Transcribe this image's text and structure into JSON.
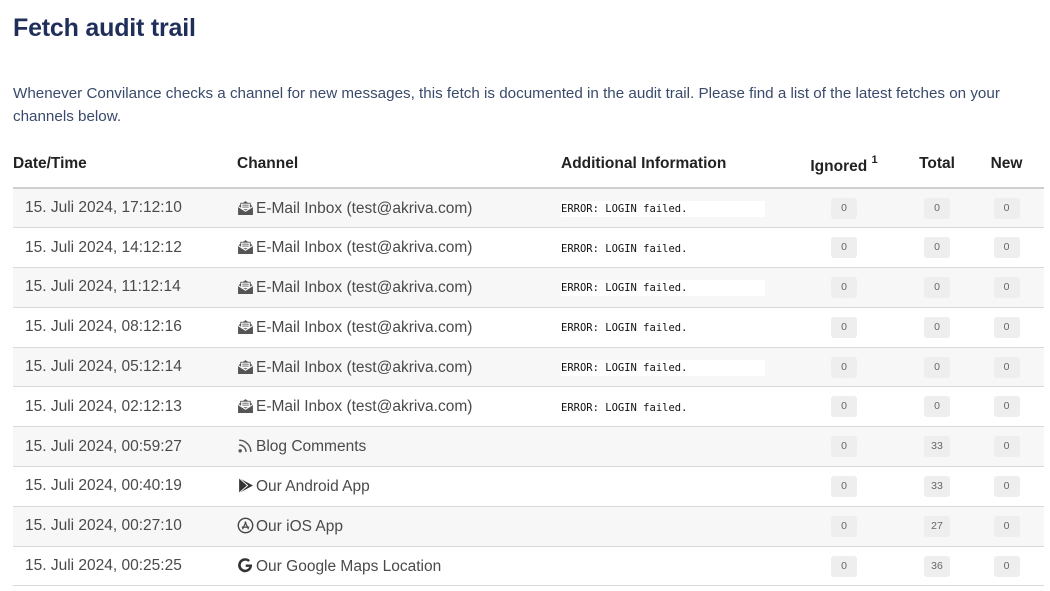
{
  "page": {
    "title": "Fetch audit trail",
    "intro": "Whenever Convilance checks a channel for new messages, this fetch is documented in the audit trail. Please find a list of the latest fetches on your channels below."
  },
  "table": {
    "headers": {
      "datetime": "Date/Time",
      "channel": "Channel",
      "info": "Additional Information",
      "ignored": "Ignored",
      "ignored_note": "1",
      "total": "Total",
      "new": "New"
    },
    "rows": [
      {
        "datetime": "15. Juli 2024, 17:12:10",
        "icon": "email-open-icon",
        "channel": "E-Mail Inbox (test@akriva.com)",
        "info": "ERROR: LOGIN failed.",
        "ignored": "0",
        "total": "0",
        "new": "0"
      },
      {
        "datetime": "15. Juli 2024, 14:12:12",
        "icon": "email-open-icon",
        "channel": "E-Mail Inbox (test@akriva.com)",
        "info": "ERROR: LOGIN failed.",
        "ignored": "0",
        "total": "0",
        "new": "0"
      },
      {
        "datetime": "15. Juli 2024, 11:12:14",
        "icon": "email-open-icon",
        "channel": "E-Mail Inbox (test@akriva.com)",
        "info": "ERROR: LOGIN failed.",
        "ignored": "0",
        "total": "0",
        "new": "0"
      },
      {
        "datetime": "15. Juli 2024, 08:12:16",
        "icon": "email-open-icon",
        "channel": "E-Mail Inbox (test@akriva.com)",
        "info": "ERROR: LOGIN failed.",
        "ignored": "0",
        "total": "0",
        "new": "0"
      },
      {
        "datetime": "15. Juli 2024, 05:12:14",
        "icon": "email-open-icon",
        "channel": "E-Mail Inbox (test@akriva.com)",
        "info": "ERROR: LOGIN failed.",
        "ignored": "0",
        "total": "0",
        "new": "0"
      },
      {
        "datetime": "15. Juli 2024, 02:12:13",
        "icon": "email-open-icon",
        "channel": "E-Mail Inbox (test@akriva.com)",
        "info": "ERROR: LOGIN failed.",
        "ignored": "0",
        "total": "0",
        "new": "0"
      },
      {
        "datetime": "15. Juli 2024, 00:59:27",
        "icon": "rss-icon",
        "channel": "Blog Comments",
        "info": "",
        "ignored": "0",
        "total": "33",
        "new": "0"
      },
      {
        "datetime": "15. Juli 2024, 00:40:19",
        "icon": "google-play-icon",
        "channel": "Our Android App",
        "info": "",
        "ignored": "0",
        "total": "33",
        "new": "0"
      },
      {
        "datetime": "15. Juli 2024, 00:27:10",
        "icon": "app-store-icon",
        "channel": "Our iOS App",
        "info": "",
        "ignored": "0",
        "total": "27",
        "new": "0"
      },
      {
        "datetime": "15. Juli 2024, 00:25:25",
        "icon": "google-icon",
        "channel": "Our Google Maps Location",
        "info": "",
        "ignored": "0",
        "total": "36",
        "new": "0"
      }
    ]
  }
}
